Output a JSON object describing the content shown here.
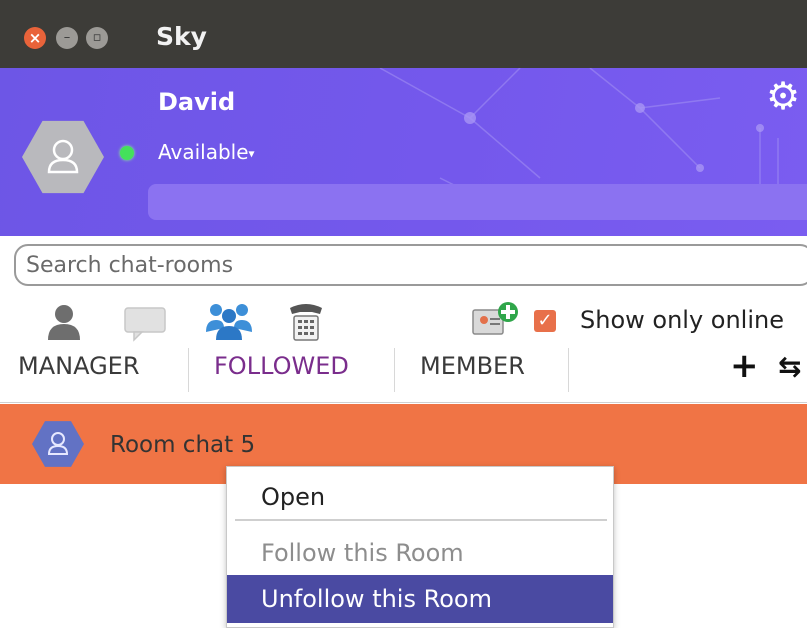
{
  "window": {
    "title": "Sky"
  },
  "profile": {
    "name": "David",
    "status": "Available",
    "status_caret": "▾",
    "online_color": "#44e15b"
  },
  "search": {
    "placeholder": "Search chat-rooms",
    "value": ""
  },
  "toolbar": {
    "icons": [
      "contact-icon",
      "chat-bubble-icon",
      "group-icon",
      "phone-icon",
      "add-contact-icon"
    ],
    "show_online_label": "Show only online",
    "show_online_checked": true
  },
  "tabs": {
    "manager": "MANAGER",
    "followed": "FOLLOWED",
    "member": "MEMBER",
    "active": "FOLLOWED",
    "add_glyph": "+",
    "sync_glyph": "⇆"
  },
  "rooms": [
    {
      "name": "Room chat 5",
      "selected": true
    }
  ],
  "context_menu": {
    "open": "Open",
    "follow": "Follow this Room",
    "unfollow": "Unfollow this Room"
  },
  "colors": {
    "header": "#7458ec",
    "selected_row": "#f07445",
    "menu_highlight": "#4a4aa2",
    "active_tab": "#7a2d8c"
  }
}
